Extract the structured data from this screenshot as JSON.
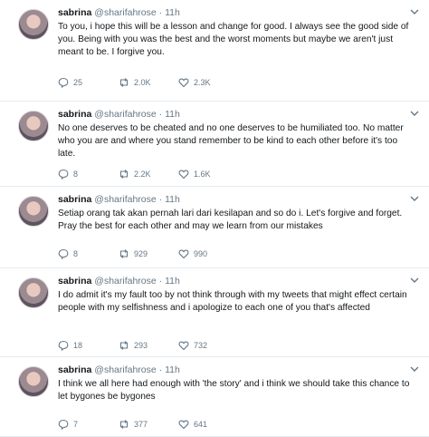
{
  "tweets": [
    {
      "name": "sabrina",
      "handle": "@sharifahrose",
      "sep": " · ",
      "time": "11h",
      "text": "To you, i hope this will be a lesson and change for good. I always see the good side of you. Being with you was the best and the worst moments but maybe we aren't just meant to be. I forgive you.",
      "replies": "25",
      "retweets": "2.0K",
      "likes": "2.3K"
    },
    {
      "name": "sabrina",
      "handle": "@sharifahrose",
      "sep": " · ",
      "time": "11h",
      "text": "No one deserves to be cheated and no one deserves to be humiliated too. No matter who you are and where you stand remember to be kind to each other before it's too late.",
      "replies": "8",
      "retweets": "2.2K",
      "likes": "1.6K"
    },
    {
      "name": "sabrina",
      "handle": "@sharifahrose",
      "sep": " · ",
      "time": "11h",
      "text": "Setiap orang tak akan pernah lari dari kesilapan and so do i. Let's forgive and forget. Pray the best for each other and may we learn from our mistakes",
      "replies": "8",
      "retweets": "929",
      "likes": "990"
    },
    {
      "name": "sabrina",
      "handle": "@sharifahrose",
      "sep": " · ",
      "time": "11h",
      "text": "I do admit it's my fault too by not think through with my tweets that might effect certain people with my selfishness and i apologize to each one of you that's affected",
      "replies": "18",
      "retweets": "293",
      "likes": "732"
    },
    {
      "name": "sabrina",
      "handle": "@sharifahrose",
      "sep": " · ",
      "time": "11h",
      "text": "I think we all here had enough with 'the story' and i think we should take this chance to let bygones be bygones",
      "replies": "7",
      "retweets": "377",
      "likes": "641"
    }
  ],
  "icons": {
    "reply": "reply-icon",
    "retweet": "retweet-icon",
    "like": "heart-icon",
    "more": "chevron-down-icon"
  },
  "colors": {
    "secondary_text": "#657786",
    "divider": "#e6ecf0"
  }
}
